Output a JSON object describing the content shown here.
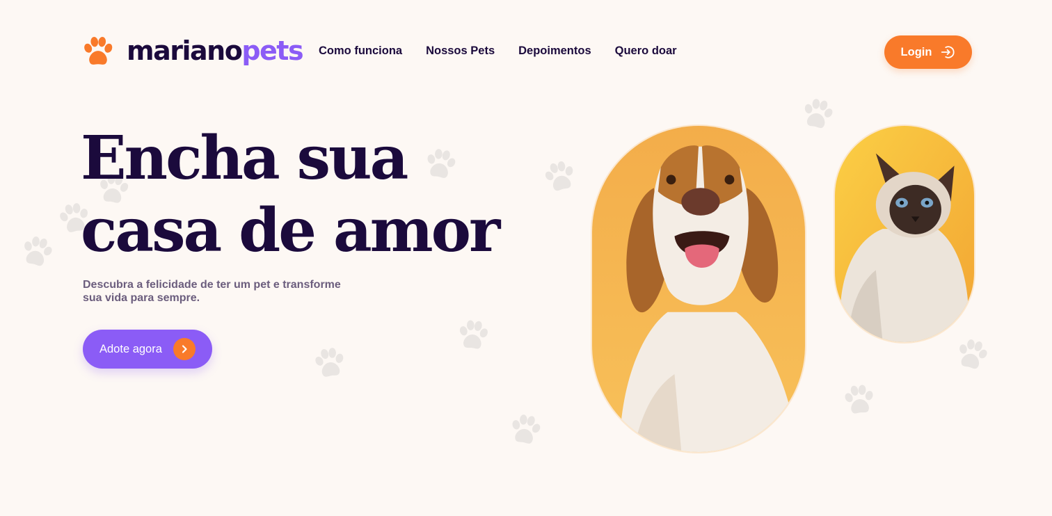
{
  "brand": {
    "name_part1": "mariano",
    "name_part2": "pets",
    "logo_icon": "paw-icon",
    "primary_color": "#f97a2a",
    "accent_color": "#8b5cf6",
    "text_color": "#1b0a3c"
  },
  "nav": {
    "items": [
      {
        "label": "Como funciona"
      },
      {
        "label": "Nossos Pets"
      },
      {
        "label": "Depoimentos"
      },
      {
        "label": "Quero doar"
      }
    ],
    "login_label": "Login",
    "login_icon": "login-arrow-icon"
  },
  "hero": {
    "headline_line1": "Encha sua",
    "headline_line2": "casa de amor",
    "subtitle": "Descubra a felicidade de ter um pet e transforme sua vida para sempre.",
    "cta_label": "Adote agora",
    "cta_icon": "chevron-right-icon"
  },
  "images": {
    "dog_photo": "dog-photo",
    "cat_photo": "cat-photo",
    "photo_background": "#f6b447"
  }
}
